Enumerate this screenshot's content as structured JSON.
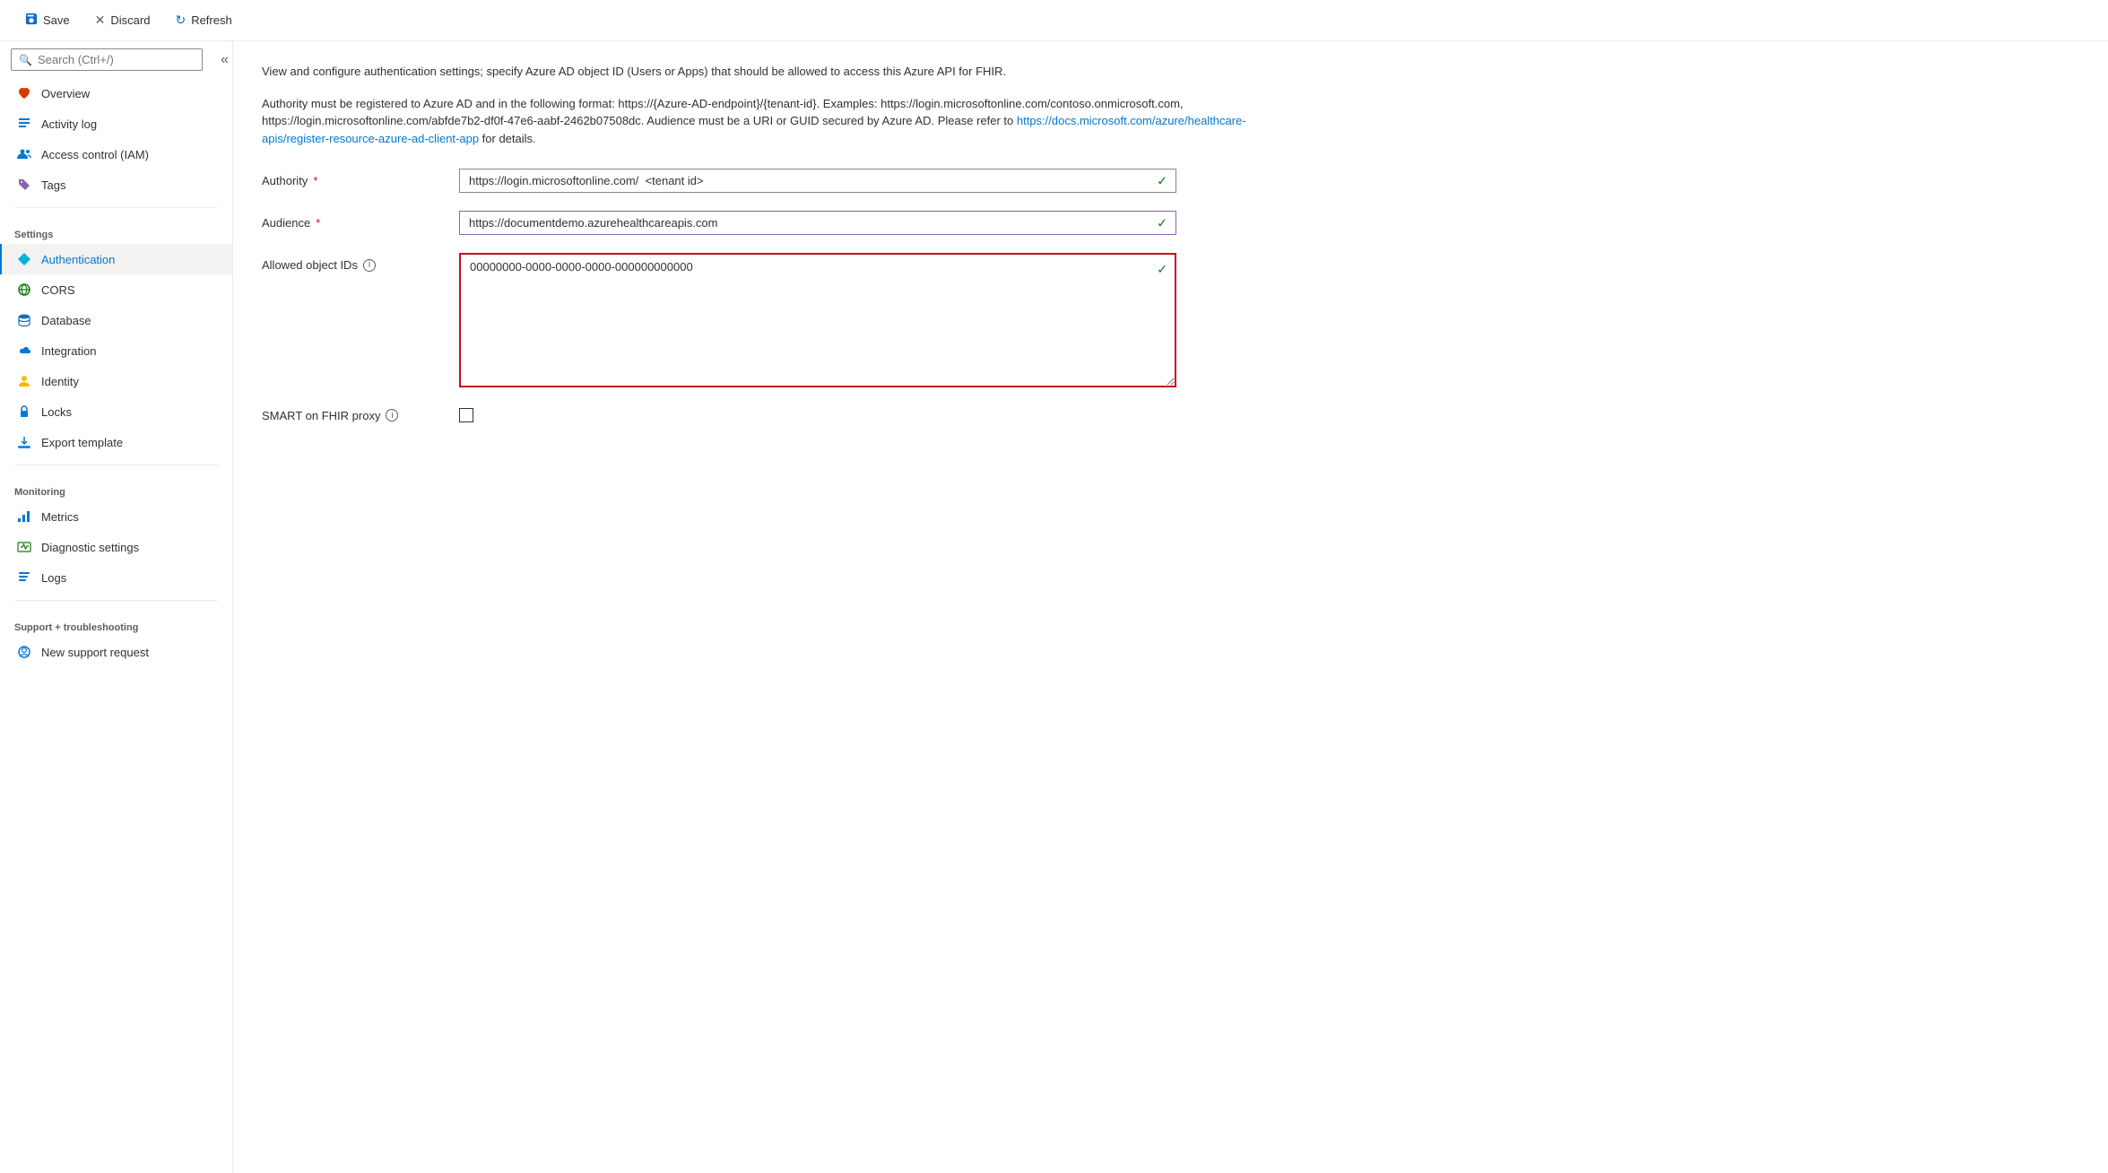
{
  "toolbar": {
    "save_label": "Save",
    "discard_label": "Discard",
    "refresh_label": "Refresh"
  },
  "search": {
    "placeholder": "Search (Ctrl+/)"
  },
  "sidebar": {
    "sections": [
      {
        "items": [
          {
            "id": "overview",
            "label": "Overview",
            "icon": "heart-icon",
            "icon_color": "icon-orange"
          },
          {
            "id": "activity-log",
            "label": "Activity log",
            "icon": "list-icon",
            "icon_color": "icon-blue"
          },
          {
            "id": "access-control",
            "label": "Access control (IAM)",
            "icon": "people-icon",
            "icon_color": "icon-blue"
          },
          {
            "id": "tags",
            "label": "Tags",
            "icon": "tag-icon",
            "icon_color": "icon-purple"
          }
        ]
      },
      {
        "label": "Settings",
        "items": [
          {
            "id": "authentication",
            "label": "Authentication",
            "icon": "diamond-icon",
            "icon_color": "icon-cyan",
            "active": true
          },
          {
            "id": "cors",
            "label": "CORS",
            "icon": "cors-icon",
            "icon_color": "icon-green"
          },
          {
            "id": "database",
            "label": "Database",
            "icon": "db-icon",
            "icon_color": "icon-blue2"
          },
          {
            "id": "integration",
            "label": "Integration",
            "icon": "cloud-icon",
            "icon_color": "icon-blue"
          },
          {
            "id": "identity",
            "label": "Identity",
            "icon": "identity-icon",
            "icon_color": "icon-yellow"
          },
          {
            "id": "locks",
            "label": "Locks",
            "icon": "lock-icon",
            "icon_color": "icon-blue"
          },
          {
            "id": "export-template",
            "label": "Export template",
            "icon": "export-icon",
            "icon_color": "icon-blue"
          }
        ]
      },
      {
        "label": "Monitoring",
        "items": [
          {
            "id": "metrics",
            "label": "Metrics",
            "icon": "metrics-icon",
            "icon_color": "icon-blue"
          },
          {
            "id": "diagnostic-settings",
            "label": "Diagnostic settings",
            "icon": "diagnostic-icon",
            "icon_color": "icon-green"
          },
          {
            "id": "logs",
            "label": "Logs",
            "icon": "logs-icon",
            "icon_color": "icon-blue"
          }
        ]
      },
      {
        "label": "Support + troubleshooting",
        "items": [
          {
            "id": "new-support-request",
            "label": "New support request",
            "icon": "support-icon",
            "icon_color": "icon-blue"
          }
        ]
      }
    ]
  },
  "content": {
    "description1": "View and configure authentication settings; specify Azure AD object ID (Users or Apps) that should be allowed to access this Azure API for FHIR.",
    "description2": "Authority must be registered to Azure AD and in the following format: https://{Azure-AD-endpoint}/{tenant-id}. Examples: https://login.microsoftonline.com/contoso.onmicrosoft.com, https://login.microsoftonline.com/abfde7b2-df0f-47e6-aabf-2462b07508dc. Audience must be a URI or GUID secured by Azure AD. Please refer to ",
    "description_link_text": "https://docs.microsoft.com/azure/healthcare-apis/register-resource-azure-ad-client-app",
    "description_link_href": "https://docs.microsoft.com/azure/healthcare-apis/register-resource-azure-ad-client-app",
    "description3": " for details.",
    "authority_label": "Authority",
    "authority_value": "https://login.microsoftonline.com/  <tenant id>",
    "audience_label": "Audience",
    "audience_value": "https://documentdemo.azurehealthcareapis.com",
    "allowed_ids_label": "Allowed object IDs",
    "allowed_ids_value": "00000000-0000-0000-0000-000000000000",
    "smart_proxy_label": "SMART on FHIR proxy"
  }
}
